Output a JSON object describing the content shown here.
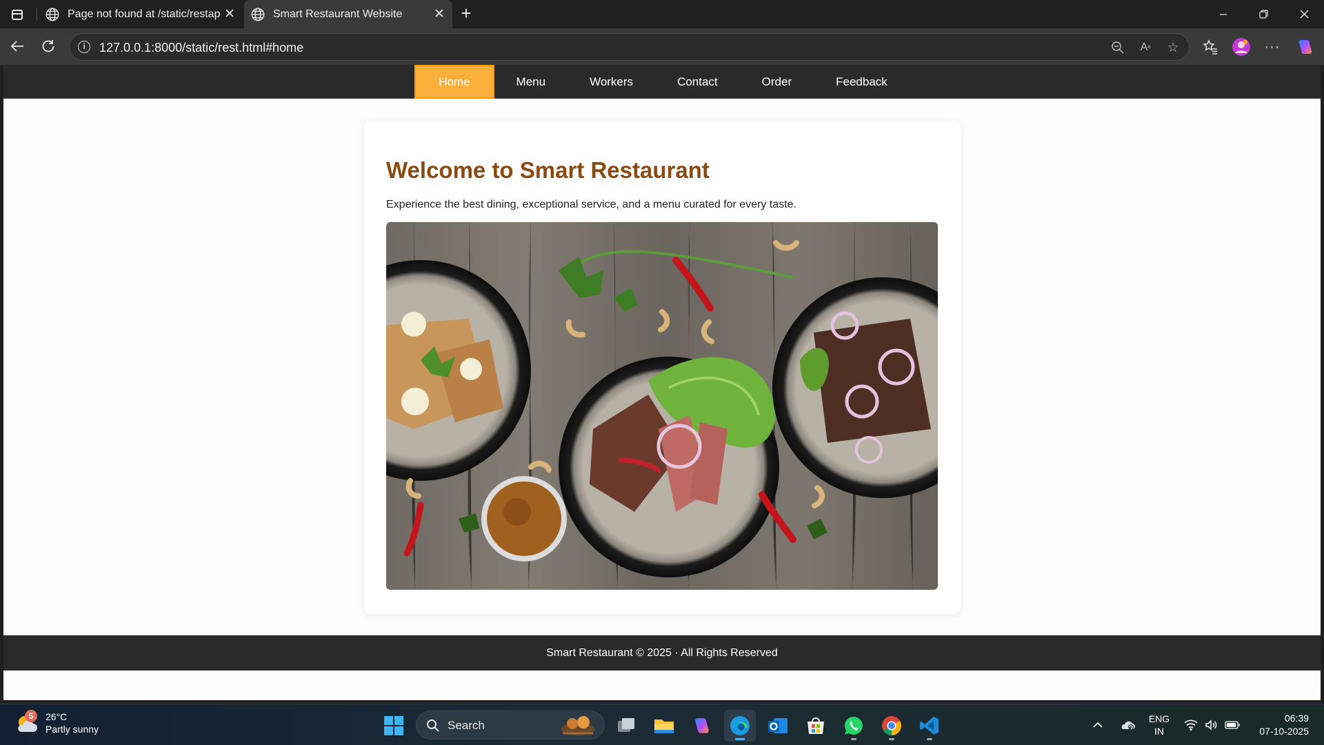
{
  "browser": {
    "tabs": [
      {
        "title": "Page not found at /static/restapp",
        "active": false
      },
      {
        "title": "Smart Restaurant Website",
        "active": true
      }
    ],
    "url": "127.0.0.1:8000/static/rest.html#home",
    "icons": [
      "back-icon",
      "refresh-icon",
      "site-info-icon",
      "zoom-out-icon",
      "read-aloud-icon",
      "favorite-star-icon",
      "favorites-icon",
      "profile-avatar",
      "more-icon",
      "copilot-icon"
    ]
  },
  "site": {
    "nav": [
      {
        "label": "Home",
        "active": true
      },
      {
        "label": "Menu",
        "active": false
      },
      {
        "label": "Workers",
        "active": false
      },
      {
        "label": "Contact",
        "active": false
      },
      {
        "label": "Order",
        "active": false
      },
      {
        "label": "Feedback",
        "active": false
      }
    ],
    "heading": "Welcome to Smart Restaurant",
    "tagline": "Experience the best dining, exceptional service, and a menu curated for every taste.",
    "footer": "Smart Restaurant © 2025 · All Rights Reserved",
    "colors": {
      "accent": "#fbb03b",
      "heading": "#8a4a10",
      "nav_bg": "#2a2a2a"
    }
  },
  "taskbar": {
    "weather": {
      "badge": "5",
      "temp": "26°C",
      "condition": "Partly sunny"
    },
    "search_label": "Search",
    "apps": [
      "windows-start",
      "task-view",
      "file-explorer",
      "copilot",
      "edge",
      "outlook",
      "microsoft-store",
      "whatsapp",
      "chrome",
      "vscode"
    ],
    "lang": {
      "line1": "ENG",
      "line2": "IN"
    },
    "time": "06:39",
    "date": "07-10-2025"
  }
}
